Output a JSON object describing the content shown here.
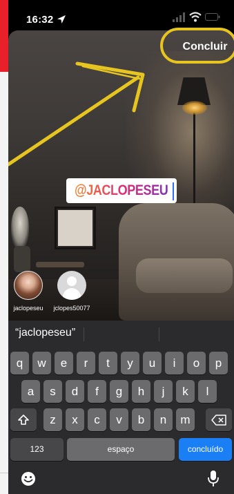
{
  "status_bar": {
    "time": "16:32"
  },
  "header": {
    "done_label": "Concluir"
  },
  "sticker": {
    "text": "@JACLOPESEU"
  },
  "mentions": [
    {
      "username": "jaclopeseu"
    },
    {
      "username": "jclopes50077"
    }
  ],
  "keyboard": {
    "prediction": "“jaclopeseu”",
    "row1": [
      "q",
      "w",
      "e",
      "r",
      "t",
      "y",
      "u",
      "i",
      "o",
      "p"
    ],
    "row2": [
      "a",
      "s",
      "d",
      "f",
      "g",
      "h",
      "j",
      "k",
      "l"
    ],
    "row3": [
      "z",
      "x",
      "c",
      "v",
      "b",
      "n",
      "m"
    ],
    "numbers_label": "123",
    "space_label": "espaço",
    "return_label": "concluído"
  },
  "colors": {
    "highlight": "#e6c521",
    "return_key": "#1a7ff5",
    "status_accent": "#e8202a"
  },
  "icons": [
    "location-arrow-icon",
    "signal-icon",
    "wifi-icon",
    "battery-icon",
    "shift-icon",
    "backspace-icon",
    "emoji-icon",
    "microphone-icon",
    "arrow-annotation"
  ]
}
